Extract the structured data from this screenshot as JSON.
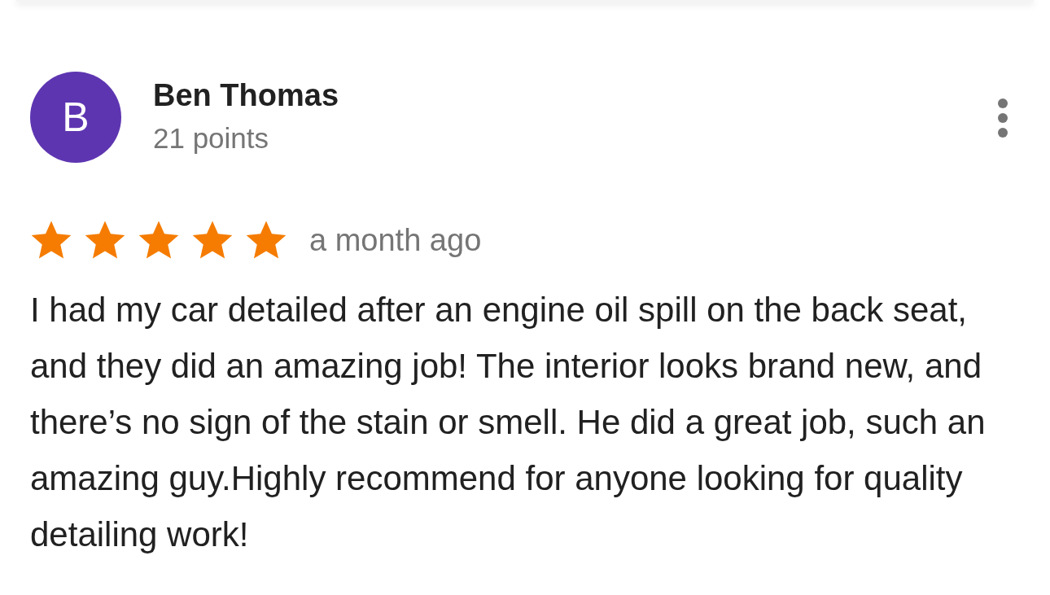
{
  "review": {
    "avatar_letter": "B",
    "author": "Ben Thomas",
    "points": "21 points",
    "stars": 5,
    "time": "a month ago",
    "text": "I had my car detailed after an engine oil spill on the back seat, and they did an amazing job! The interior looks brand new, and there’s no sign of the stain or smell. He did a great job, such an amazing guy.Highly recommend for anyone looking for quality detailing work!"
  }
}
